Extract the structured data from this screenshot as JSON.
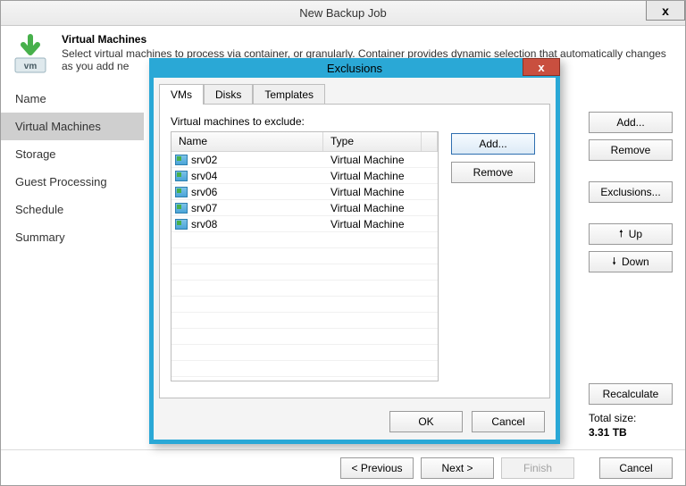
{
  "window": {
    "title": "New Backup Job",
    "close_x": "x"
  },
  "header": {
    "title": "Virtual Machines",
    "desc": "Select virtual machines to process via container, or granularly. Container provides dynamic selection that automatically changes as you add ne"
  },
  "nav": {
    "items": [
      {
        "label": "Name"
      },
      {
        "label": "Virtual Machines"
      },
      {
        "label": "Storage"
      },
      {
        "label": "Guest Processing"
      },
      {
        "label": "Schedule"
      },
      {
        "label": "Summary"
      }
    ],
    "active_index": 1
  },
  "right_panel": {
    "add": "Add...",
    "remove": "Remove",
    "exclusions": "Exclusions...",
    "up": "Up",
    "down": "Down",
    "recalculate": "Recalculate",
    "total_label": "Total size:",
    "total_value": "3.31 TB"
  },
  "footer": {
    "previous": "< Previous",
    "next": "Next >",
    "finish": "Finish",
    "cancel": "Cancel"
  },
  "modal": {
    "title": "Exclusions",
    "close_x": "x",
    "tabs": {
      "vms": "VMs",
      "disks": "Disks",
      "templates": "Templates"
    },
    "pane_label": "Virtual machines to exclude:",
    "columns": {
      "name": "Name",
      "type": "Type"
    },
    "rows": [
      {
        "name": "srv02",
        "type": "Virtual Machine"
      },
      {
        "name": "srv04",
        "type": "Virtual Machine"
      },
      {
        "name": "srv06",
        "type": "Virtual Machine"
      },
      {
        "name": "srv07",
        "type": "Virtual Machine"
      },
      {
        "name": "srv08",
        "type": "Virtual Machine"
      }
    ],
    "buttons": {
      "add": "Add...",
      "remove": "Remove",
      "ok": "OK",
      "cancel": "Cancel"
    }
  }
}
